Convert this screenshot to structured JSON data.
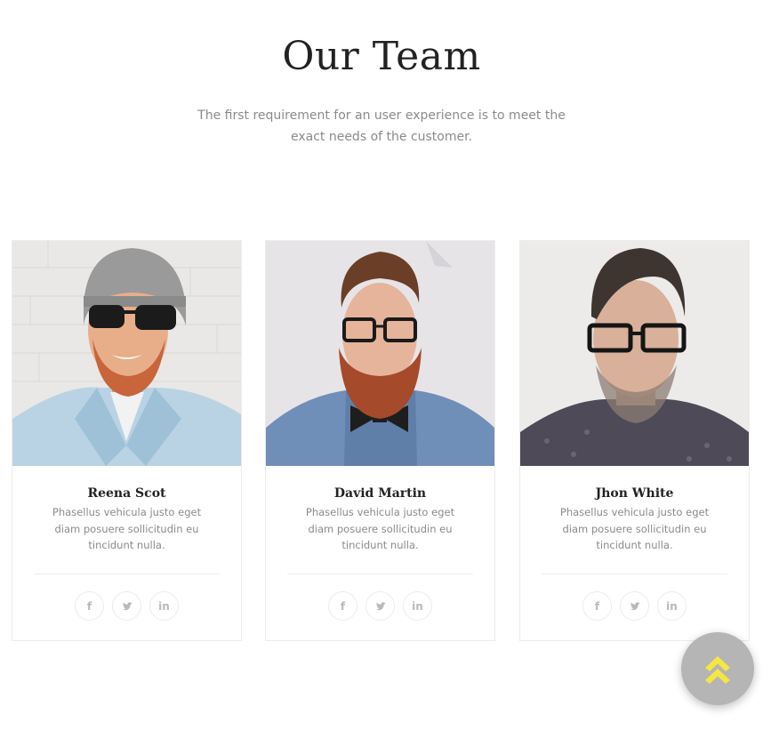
{
  "section": {
    "title": "Our Team",
    "subtitle": "The first requirement for an user experience is to meet the exact needs of the customer."
  },
  "team": [
    {
      "name": "Reena Scot",
      "description": "Phasellus vehicula justo eget diam posuere sollicitudin eu tincidunt nulla.",
      "photo": "man-with-beanie-and-sunglasses"
    },
    {
      "name": "David Martin",
      "description": "Phasellus vehicula justo eget diam posuere sollicitudin eu tincidunt nulla.",
      "photo": "man-with-beard-glasses-bowtie"
    },
    {
      "name": "Jhon White",
      "description": "Phasellus vehicula justo eget diam posuere sollicitudin eu tincidunt nulla.",
      "photo": "man-with-glasses-stubble"
    }
  ],
  "social": {
    "facebook_icon": "f",
    "twitter_icon": "twitter-bird-icon",
    "linkedin_icon": "in"
  },
  "back_to_top": {
    "icon": "double-chevron-up-icon",
    "icon_color": "#f5e642",
    "background": "#b5b5b5"
  }
}
